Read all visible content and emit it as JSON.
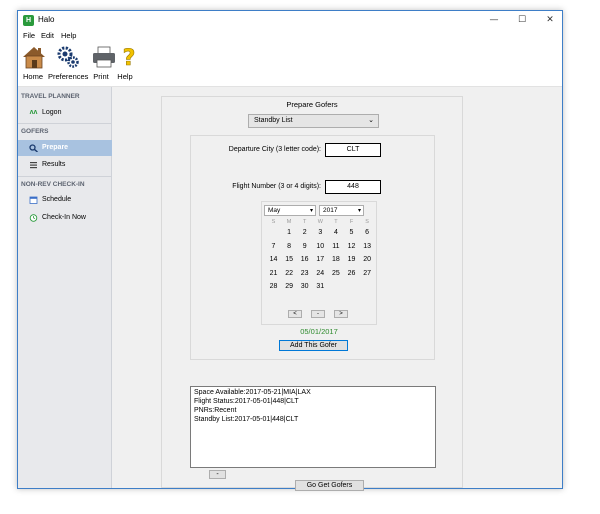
{
  "window": {
    "title": "Halo",
    "app_icon_text": "H"
  },
  "window_controls": {
    "minimize": "—",
    "maximize": "☐",
    "close": "✕"
  },
  "menu": [
    "File",
    "Edit",
    "Help"
  ],
  "toolbar": {
    "home": "Home",
    "preferences": "Preferences",
    "print": "Print",
    "help": "Help"
  },
  "sidebar": {
    "travel_planner": {
      "heading": "TRAVEL PLANNER",
      "items": [
        {
          "label": "Logon",
          "icon": "logon-icon"
        }
      ]
    },
    "gofers": {
      "heading": "GOFERS",
      "items": [
        {
          "label": "Prepare",
          "icon": "search-gear-icon",
          "active": true
        },
        {
          "label": "Results",
          "icon": "list-icon"
        }
      ]
    },
    "nonrev": {
      "heading": "NON-REV CHECK-IN",
      "items": [
        {
          "label": "Schedule",
          "icon": "calendar-icon"
        },
        {
          "label": "Check-In Now",
          "icon": "clock-icon"
        }
      ]
    }
  },
  "main": {
    "title": "Prepare Gofers",
    "type_select": "Standby List",
    "departure_label": "Departure City (3 letter code):",
    "departure_value": "CLT",
    "flight_label": "Flight Number (3 or 4 digits):",
    "flight_value": "448",
    "calendar": {
      "month": "May",
      "year": "2017",
      "dow": [
        "S",
        "M",
        "T",
        "W",
        "T",
        "F",
        "S"
      ],
      "first_weekday": 1,
      "days_in_month": 31,
      "prev_label": "<",
      "today_label": "-",
      "next_label": ">"
    },
    "selected_date": "05/01/2017",
    "add_button": "Add This Gofer",
    "gofers_list": [
      "Space Available:2017-05-21|MIA|LAX",
      "Flight Status:2017-05-01|448|CLT",
      "PNRs:Recent",
      "Standby List:2017-05-01|448|CLT"
    ],
    "remove_button": "-",
    "go_button": "Go Get Gofers"
  },
  "colors": {
    "accent": "#a8c2e0",
    "selected_date": "#2e8b2e",
    "window_border": "#3e7ec7"
  }
}
